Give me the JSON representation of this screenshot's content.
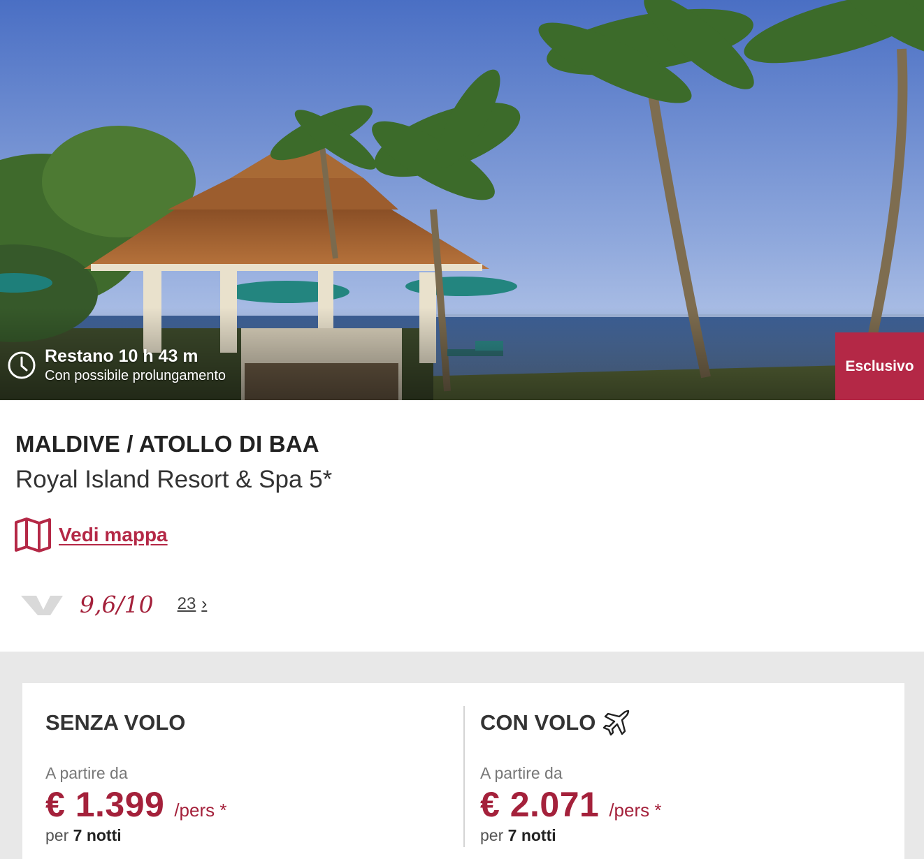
{
  "hero": {
    "timer_main": "Restano 10 h 43 m",
    "timer_sub": "Con possibile prolungamento",
    "badge": "Esclusivo"
  },
  "info": {
    "destination": "MALDIVE / ATOLLO DI BAA",
    "hotel_name": "Royal Island Resort & Spa 5*",
    "map_link": "Vedi mappa",
    "rating_score": "9,6/10",
    "review_count": "23"
  },
  "prices": {
    "without_flight": {
      "title": "SENZA VOLO",
      "from_label": "A partire da",
      "price": "€ 1.399",
      "unit": "/pers *",
      "nights_prefix": "per",
      "nights": "7 notti"
    },
    "with_flight": {
      "title": "CON VOLO",
      "from_label": "A partire da",
      "price": "€ 2.071",
      "unit": "/pers *",
      "nights_prefix": "per",
      "nights": "7 notti"
    }
  },
  "colors": {
    "accent": "#a4213b",
    "badge": "#b42846",
    "section_bg": "#e8e8e8"
  },
  "icons": [
    "clock-icon",
    "map-icon",
    "rating-logo-icon",
    "chevron-right-icon",
    "plane-icon"
  ]
}
